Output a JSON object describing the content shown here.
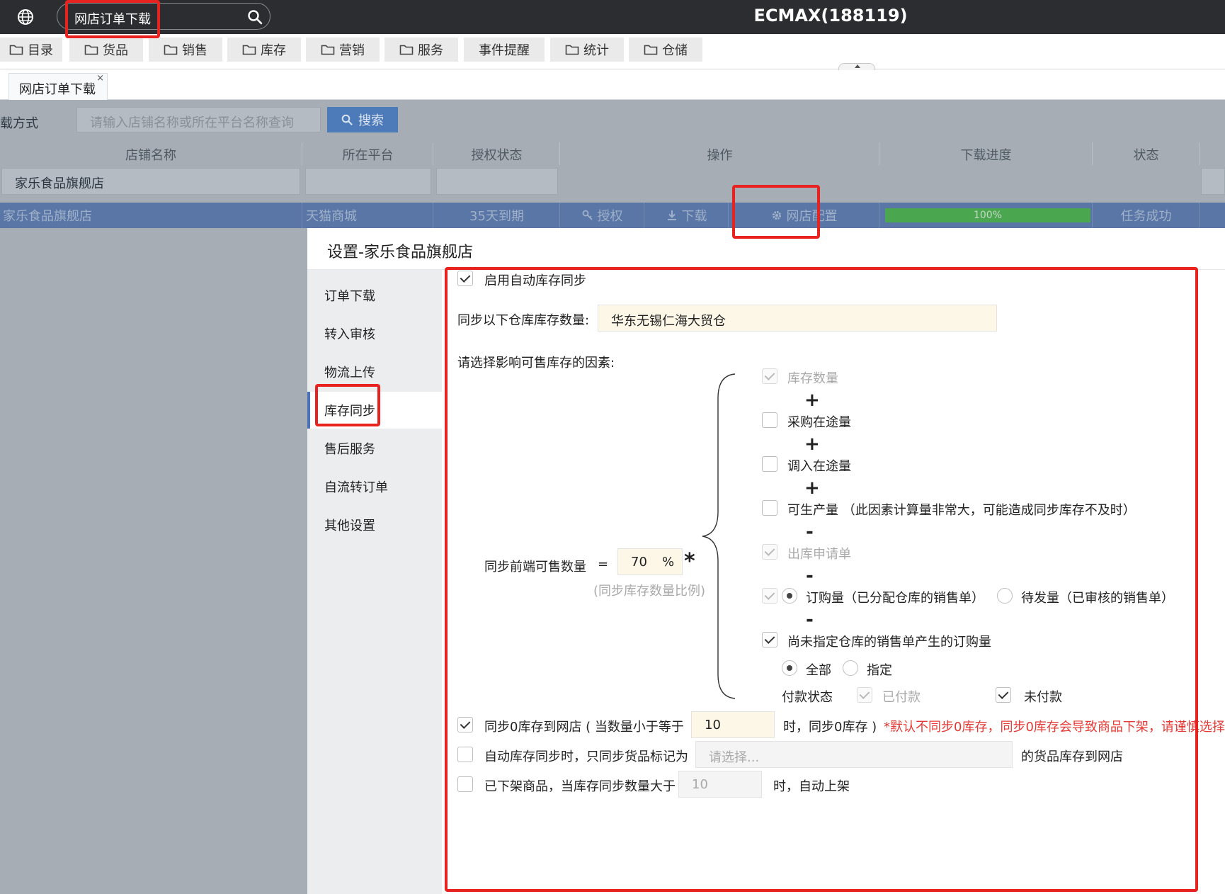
{
  "header": {
    "search_value": "网店订单下载",
    "app_title": "ECMAX(188119)"
  },
  "menu": [
    "目录",
    "货品",
    "销售",
    "库存",
    "营销",
    "服务",
    "事件提醒",
    "统计",
    "仓储"
  ],
  "tab": {
    "label": "网店订单下载",
    "close": "×"
  },
  "filter": {
    "label": "载方式",
    "placeholder": "请输入店铺名称或所在平台名称查询",
    "search_button": "搜索"
  },
  "columns": [
    "店铺名称",
    "所在平台",
    "授权状态",
    "操作",
    "下载进度",
    "状态"
  ],
  "column_filter": "家乐食品旗舰店",
  "row": {
    "shop": "家乐食品旗舰店",
    "platform": "天猫商城",
    "auth": "35天到期",
    "action_authorize": "授权",
    "action_download": "下载",
    "action_config": "网店配置",
    "progress": 100,
    "progress_label": "100%",
    "status": "任务成功"
  },
  "modal": {
    "title": "设置-家乐食品旗舰店",
    "nav": [
      "订单下载",
      "转入审核",
      "物流上传",
      "库存同步",
      "售后服务",
      "自流转订单",
      "其他设置"
    ],
    "active_nav": "库存同步",
    "enable_label": "启用自动库存同步",
    "enable_checked": true,
    "warehouse_label": "同步以下仓库库存数量:",
    "warehouse_value": "华东无锡仁海大贸仓",
    "factors_label": "请选择影响可售库存的因素:",
    "formula_label": "同步前端可售数量",
    "equals": "=",
    "ratio_value": "70",
    "ratio_unit": "%",
    "times": "*",
    "ratio_hint": "(同步库存数量比例)",
    "factors": [
      {
        "label": "库存数量",
        "checked": true,
        "disabled": true
      },
      {
        "op": "+"
      },
      {
        "label": "采购在途量",
        "checked": false,
        "disabled": false
      },
      {
        "op": "+"
      },
      {
        "label": "调入在途量",
        "checked": false,
        "disabled": false
      },
      {
        "op": "+"
      },
      {
        "label": "可生产量 （此因素计算量非常大，可能造成同步库存不及时）",
        "checked": false,
        "disabled": false
      },
      {
        "op": "-"
      },
      {
        "label": "出库申请单",
        "checked": true,
        "disabled": true
      },
      {
        "op": "-"
      },
      {
        "label": "订购量（已分配仓库的销售单）",
        "alt_label": "待发量（已审核的销售单）",
        "checked": true,
        "disabled": true,
        "radio_selected": "first"
      },
      {
        "op": "-"
      },
      {
        "label": "尚未指定仓库的销售单产生的订购量",
        "checked": true,
        "disabled": false
      }
    ],
    "scope_all": "全部",
    "scope_specified": "指定",
    "pay_status_label": "付款状态",
    "paid_label": "已付款",
    "paid_checked": true,
    "unpaid_label": "未付款",
    "unpaid_checked": true,
    "sync_zero_label": "同步0库存到网店 ( 当数量小于等于",
    "sync_zero_value": "10",
    "sync_zero_suffix": "时，同步0库存 )",
    "sync_zero_warning": "*默认不同步0库存，同步0库存会导致商品下架，请谨慎选择",
    "sync_zero_checked": true,
    "mark_label": "自动库存同步时，只同步货品标记为",
    "mark_placeholder": "请选择...",
    "mark_suffix": "的货品库存到网店",
    "mark_checked": false,
    "relist_label": "已下架商品，当库存同步数量大于",
    "relist_value": "10",
    "relist_suffix": "时，自动上架",
    "relist_checked": false
  },
  "colors": {
    "topbar": "#2b2d30",
    "selected_row": "#5a76a6",
    "progress": "#4aa74f",
    "annotation": "#e8231f",
    "warning": "#e53935",
    "accent": "#4a72b8"
  }
}
